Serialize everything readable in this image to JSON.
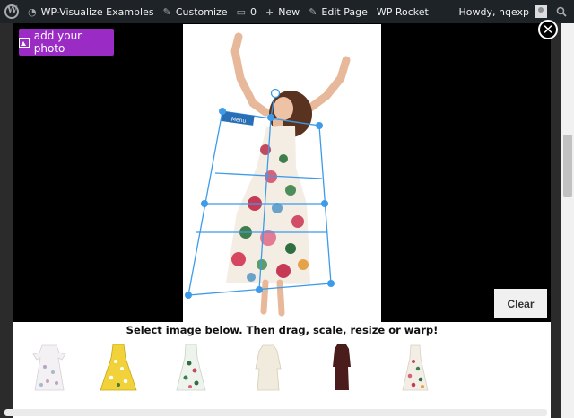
{
  "admin_bar": {
    "site_name": "WP-Visualize Examples",
    "customize": "Customize",
    "comments_count": "0",
    "new": "New",
    "edit_page": "Edit Page",
    "wp_rocket": "WP Rocket",
    "greeting": "Howdy, nqexp"
  },
  "editor": {
    "add_photo_label": "add your photo",
    "clear_label": "Clear",
    "close_glyph": "✕",
    "overlay_tag": "Menu"
  },
  "picker": {
    "title": "Select image below. Then drag, scale, resize or warp!",
    "items": [
      {
        "icon": "white-floral-dress-icon"
      },
      {
        "icon": "yellow-floral-dress-icon"
      },
      {
        "icon": "green-floral-dress-icon"
      },
      {
        "icon": "cream-dress-icon"
      },
      {
        "icon": "burgundy-dress-icon"
      },
      {
        "icon": "floral-strap-dress-icon"
      }
    ]
  },
  "colors": {
    "admin_bar_bg": "#1d2327",
    "add_photo_bg": "#9b2bc5",
    "handle_blue": "#3d9be9"
  }
}
